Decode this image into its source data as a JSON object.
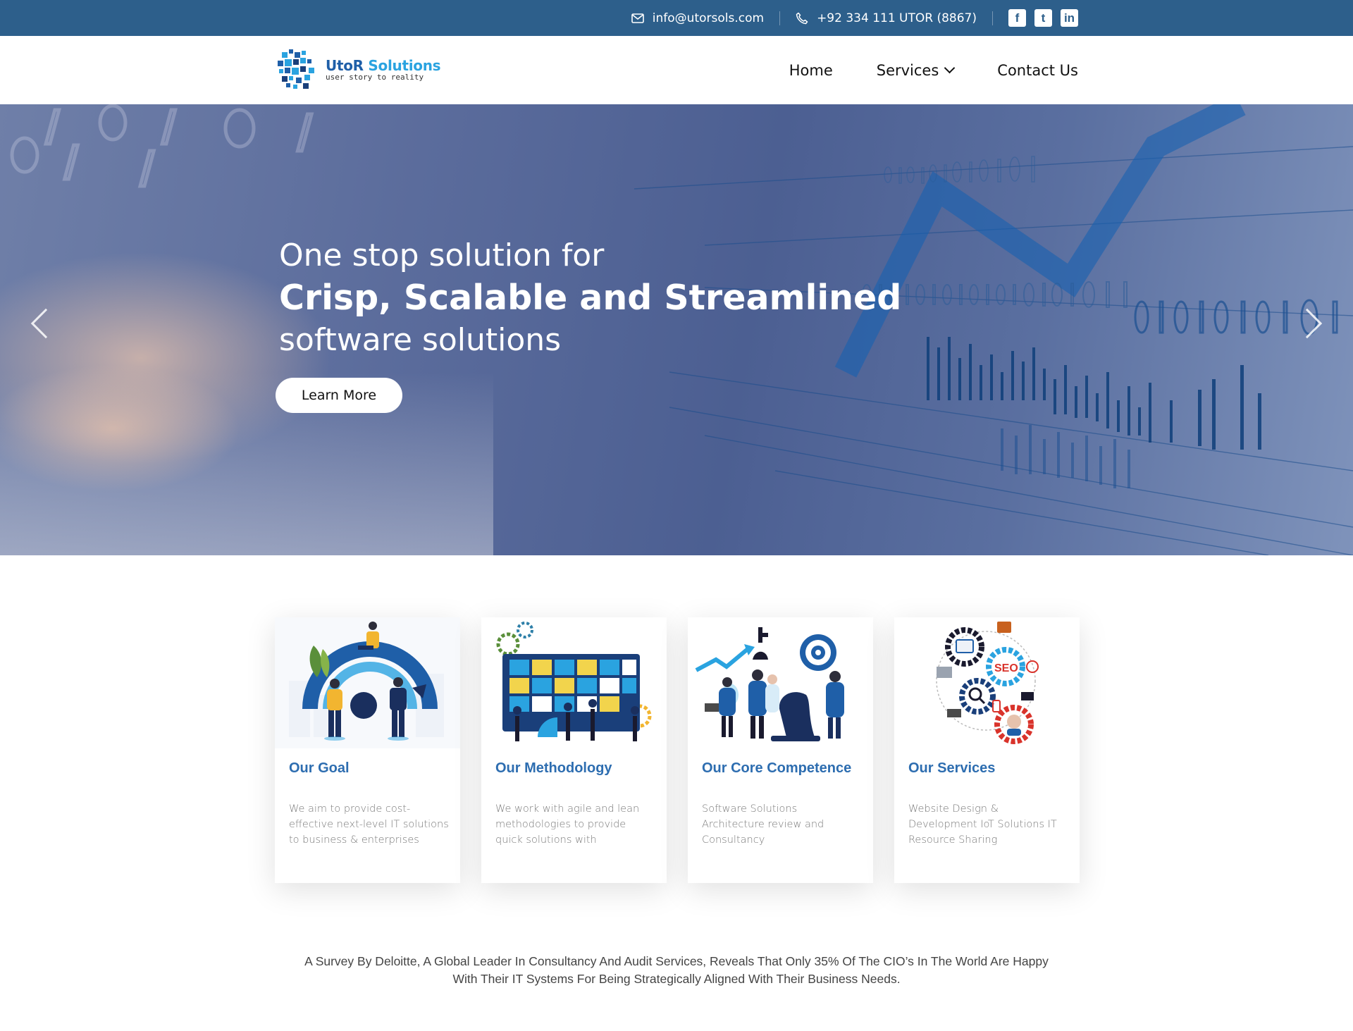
{
  "topbar": {
    "email": "info@utorsols.com",
    "phone": "+92 334 111 UTOR (8867)",
    "social": [
      {
        "icon": "facebook-icon",
        "glyph": "f"
      },
      {
        "icon": "twitter-icon",
        "glyph": "t"
      },
      {
        "icon": "linkedin-icon",
        "glyph": "in"
      }
    ]
  },
  "header": {
    "logo_name_1": "UtoR",
    "logo_name_2": "Solutions",
    "logo_tagline": "user story to reality",
    "nav": {
      "home": "Home",
      "services": "Services",
      "contact": "Contact Us"
    }
  },
  "hero": {
    "line1": "One stop solution for",
    "line2": "Crisp, Scalable and Streamlined",
    "line3": "software solutions",
    "button": "Learn More"
  },
  "cards": [
    {
      "title": "Our Goal",
      "text": "We aim to provide cost-effective next-level IT solutions to business & enterprises"
    },
    {
      "title": "Our Methodology",
      "text": "We work with agile and lean methodologies to provide quick solutions with"
    },
    {
      "title": "Our Core Competence",
      "text": "Software Solutions Architecture review and Consultancy"
    },
    {
      "title": "Our Services",
      "text": "Website Design & Development IoT Solutions IT Resource Sharing"
    }
  ],
  "survey": {
    "text": "A Survey By Deloitte, A Global Leader In Consultancy And Audit Services, Reveals That Only 35% Of The CIO’s In The World Are Happy With Their IT Systems For Being Strategically Aligned With Their Business Needs."
  },
  "colors": {
    "topbar": "#2d5f8b",
    "brand_blue": "#1f5fa8",
    "card_title": "#2d6db0"
  }
}
